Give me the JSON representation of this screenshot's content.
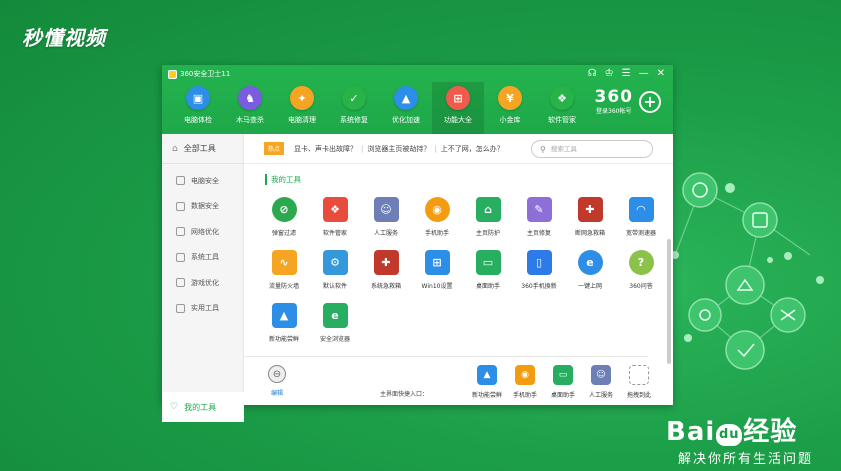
{
  "watermark": {
    "top_left": "秒懂视频",
    "baidu_logo_left": "Bai",
    "baidu_paw": "du",
    "baidu_logo_right": "经验",
    "baidu_slogan": "解决你所有生活问题"
  },
  "window": {
    "title": "360安全卫士11",
    "controls": [
      "☊",
      "♔",
      "☰",
      "—",
      "✕"
    ]
  },
  "nav": [
    {
      "label": "电脑体检",
      "icon": "monitor-icon",
      "glyph": "▣",
      "color": "#2d8ee8"
    },
    {
      "label": "木马查杀",
      "icon": "horse-icon",
      "glyph": "♞",
      "color": "#7a5ce0"
    },
    {
      "label": "电脑清理",
      "icon": "broom-icon",
      "glyph": "✦",
      "color": "#f5a523"
    },
    {
      "label": "系统修复",
      "icon": "shield-icon",
      "glyph": "✓",
      "color": "#27b348"
    },
    {
      "label": "优化加速",
      "icon": "rocket-icon",
      "glyph": "▲",
      "color": "#2d8ee8"
    },
    {
      "label": "功能大全",
      "icon": "apps-icon",
      "glyph": "⊞",
      "color": "#ef5b4c"
    },
    {
      "label": "小金库",
      "icon": "coin-icon",
      "glyph": "¥",
      "color": "#f5a523"
    },
    {
      "label": "软件管家",
      "icon": "software-icon",
      "glyph": "❖",
      "color": "#27b348"
    }
  ],
  "brand": {
    "logo": "360",
    "login": "登录360帐号",
    "plus": "+"
  },
  "sidebar": {
    "head": "全部工具",
    "items": [
      "电脑安全",
      "数据安全",
      "网络优化",
      "系统工具",
      "游戏优化",
      "实用工具"
    ],
    "my_tools": "我的工具"
  },
  "hotbar": {
    "badge": "热点",
    "links": [
      "显卡、声卡出故障？",
      "浏览器主页被劫持？",
      "上不了网，怎么办？"
    ],
    "separator": "|",
    "search_placeholder": "搜索工具"
  },
  "section_title": "我的工具",
  "tools": [
    {
      "label": "弹窗过滤",
      "glyph": "⊘",
      "color": "#2ca94f",
      "round": true
    },
    {
      "label": "软件管家",
      "glyph": "❖",
      "color": "#e74c3c",
      "round": false
    },
    {
      "label": "人工服务",
      "glyph": "☺",
      "color": "#6d7fb5",
      "round": false
    },
    {
      "label": "手机助手",
      "glyph": "◉",
      "color": "#f39c12",
      "round": true
    },
    {
      "label": "主页防护",
      "glyph": "⌂",
      "color": "#27ae60",
      "round": false
    },
    {
      "label": "主页修复",
      "glyph": "✎",
      "color": "#8e6fd8",
      "round": false
    },
    {
      "label": "断网急救箱",
      "glyph": "✚",
      "color": "#c0392b",
      "round": false
    },
    {
      "label": "宽带测速器",
      "glyph": "◠",
      "color": "#2d8ee8",
      "round": false
    },
    {
      "label": "流量防火墙",
      "glyph": "∿",
      "color": "#f5a523",
      "round": false
    },
    {
      "label": "默认软件",
      "glyph": "⚙",
      "color": "#3498db",
      "round": false
    },
    {
      "label": "系统急救箱",
      "glyph": "✚",
      "color": "#c0392b",
      "round": false
    },
    {
      "label": "Win10设置",
      "glyph": "⊞",
      "color": "#2d8ee8",
      "round": false
    },
    {
      "label": "桌面助手",
      "glyph": "▭",
      "color": "#27ae60",
      "round": false
    },
    {
      "label": "360手机換新",
      "glyph": "▯",
      "color": "#2d7be8",
      "round": false
    },
    {
      "label": "一键上网",
      "glyph": "e",
      "color": "#2d8ee8",
      "round": true
    },
    {
      "label": "360问答",
      "glyph": "?",
      "color": "#8bc34a",
      "round": true
    },
    {
      "label": "新功能尝鲜",
      "glyph": "▲",
      "color": "#2d8ee8",
      "round": false
    },
    {
      "label": "安全浏览器",
      "glyph": "e",
      "color": "#27ae60",
      "round": false
    }
  ],
  "bottom": {
    "edit_label": "编辑",
    "edit_glyph": "⊖",
    "entry_label": "主界面快捷入口：",
    "quick": [
      {
        "label": "新功能尝鲜",
        "glyph": "▲",
        "color": "#2d8ee8"
      },
      {
        "label": "手机助手",
        "glyph": "◉",
        "color": "#f39c12"
      },
      {
        "label": "桌面助手",
        "glyph": "▭",
        "color": "#27ae60"
      },
      {
        "label": "人工服务",
        "glyph": "☺",
        "color": "#6d7fb5"
      },
      {
        "label": "拖拽到此",
        "glyph": "",
        "color": "transparent"
      }
    ]
  }
}
